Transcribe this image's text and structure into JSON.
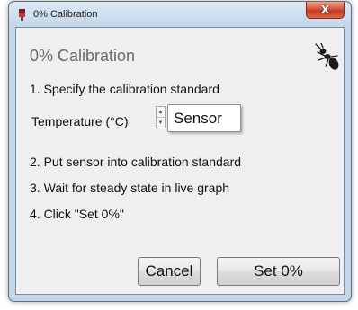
{
  "window": {
    "title": "0% Calibration",
    "close_glyph": "X"
  },
  "dialog": {
    "title": "0% Calibration",
    "logo_icon": "ant-icon",
    "steps": [
      "1. Specify the calibration standard",
      "2. Put sensor into calibration standard",
      "3. Wait for steady state in live graph",
      "4. Click \"Set 0%\""
    ],
    "temperature": {
      "label": "Temperature (°C)",
      "value": "Sensor"
    },
    "buttons": {
      "cancel": "Cancel",
      "set": "Set 0%"
    }
  },
  "colors": {
    "close_button": "#c23820",
    "title_gray": "#6b6b6b",
    "client_bg": "#efefef"
  }
}
